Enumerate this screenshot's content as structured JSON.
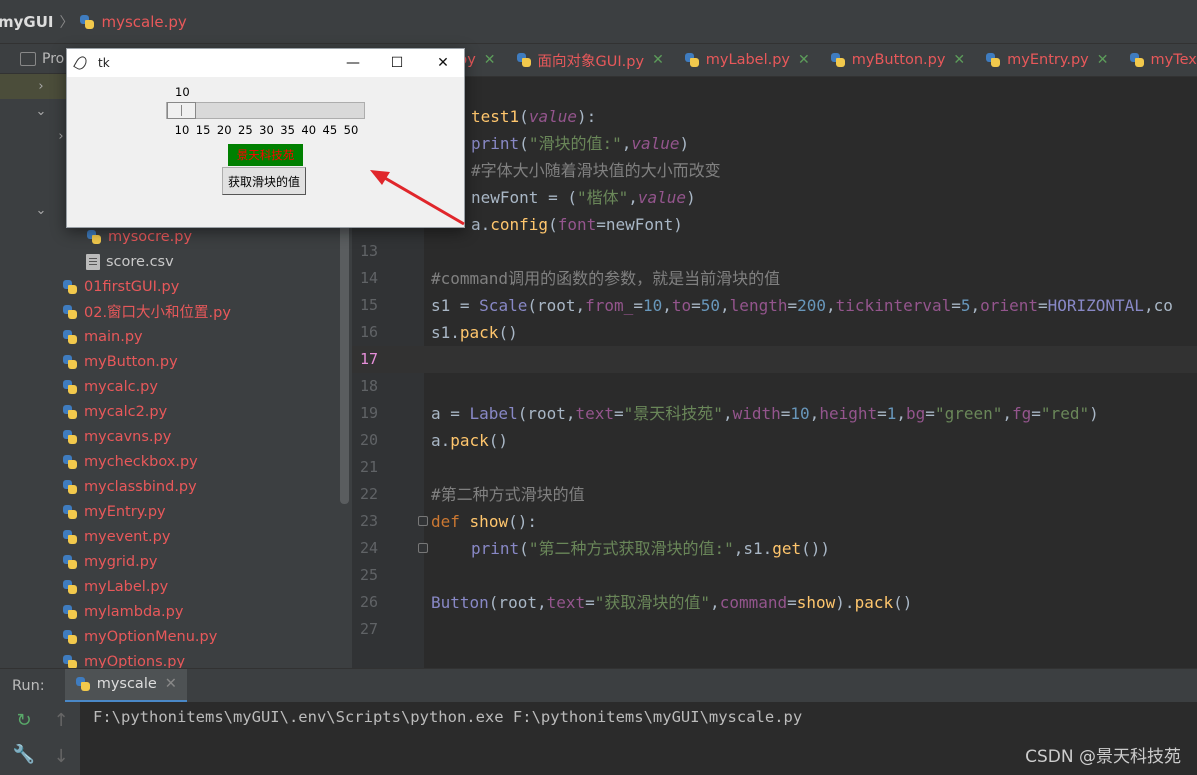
{
  "topbar": {
    "project": "myGUI",
    "separator": "〉",
    "file": "myscale.py"
  },
  "project_panel": {
    "header": "Pro",
    "files": [
      {
        "name": "mysocre.py",
        "type": "py"
      },
      {
        "name": "score.csv",
        "type": "csv"
      },
      {
        "name": "01firstGUI.py",
        "type": "py"
      },
      {
        "name": "02.窗口大小和位置.py",
        "type": "py"
      },
      {
        "name": "main.py",
        "type": "py"
      },
      {
        "name": "myButton.py",
        "type": "py"
      },
      {
        "name": "mycalc.py",
        "type": "py"
      },
      {
        "name": "mycalc2.py",
        "type": "py"
      },
      {
        "name": "mycavns.py",
        "type": "py"
      },
      {
        "name": "mycheckbox.py",
        "type": "py"
      },
      {
        "name": "myclassbind.py",
        "type": "py"
      },
      {
        "name": "myEntry.py",
        "type": "py"
      },
      {
        "name": "myevent.py",
        "type": "py"
      },
      {
        "name": "mygrid.py",
        "type": "py"
      },
      {
        "name": "myLabel.py",
        "type": "py"
      },
      {
        "name": "mylambda.py",
        "type": "py"
      },
      {
        "name": "myOptionMenu.py",
        "type": "py"
      },
      {
        "name": "myOptions.py",
        "type": "py"
      }
    ]
  },
  "tabs": [
    {
      "label": "py"
    },
    {
      "label": "面向对象GUI.py"
    },
    {
      "label": "myLabel.py"
    },
    {
      "label": "myButton.py"
    },
    {
      "label": "myEntry.py"
    },
    {
      "label": "myText.py"
    }
  ],
  "editor": {
    "current_line": "17",
    "lines": [
      {
        "n": "",
        "text": "test1(value):"
      },
      {
        "n": "",
        "text": "print(\"滑块的值:\",value)"
      },
      {
        "n": "",
        "text": "#字体大小随着滑块值的大小而改变"
      },
      {
        "n": "",
        "text": "newFont = (\"楷体\",value)"
      },
      {
        "n": "",
        "text": "a.config(font=newFont)"
      },
      {
        "n": "13",
        "text": ""
      },
      {
        "n": "14",
        "text": "#command调用的函数的参数，就是当前滑块的值"
      },
      {
        "n": "15",
        "text": "s1 = Scale(root,from_=10,to=50,length=200,tickinterval=5,orient=HORIZONTAL,co"
      },
      {
        "n": "16",
        "text": "s1.pack()"
      },
      {
        "n": "17",
        "text": ""
      },
      {
        "n": "18",
        "text": ""
      },
      {
        "n": "19",
        "text": "a = Label(root,text=\"景天科技苑\",width=10,height=1,bg=\"green\",fg=\"red\")"
      },
      {
        "n": "20",
        "text": "a.pack()"
      },
      {
        "n": "21",
        "text": ""
      },
      {
        "n": "22",
        "text": "#第二种方式滑块的值"
      },
      {
        "n": "23",
        "text": "def show():"
      },
      {
        "n": "24",
        "text": "print(\"第二种方式获取滑块的值:\",s1.get())"
      },
      {
        "n": "25",
        "text": ""
      },
      {
        "n": "26",
        "text": "Button(root,text=\"获取滑块的值\",command=show).pack()"
      },
      {
        "n": "27",
        "text": ""
      }
    ]
  },
  "run": {
    "label": "Run:",
    "tab": "myscale",
    "output": "F:\\pythonitems\\myGUI\\.env\\Scripts\\python.exe F:\\pythonitems\\myGUI\\myscale.py"
  },
  "watermark": "CSDN @景天科技苑",
  "tk": {
    "title": "tk",
    "minimize": "—",
    "maximize": "☐",
    "close": "✕",
    "scale_value": "10",
    "scale_from": 10,
    "scale_to": 50,
    "scale_current": 10,
    "ticks": [
      "10",
      "15",
      "20",
      "25",
      "30",
      "35",
      "40",
      "45",
      "50"
    ],
    "label_text": "景天科技苑",
    "button_text": "获取滑块的值"
  },
  "colors": {
    "annotation_arrow": "#e0262b",
    "label_bg": "#008000",
    "label_fg": "#ff0000"
  }
}
